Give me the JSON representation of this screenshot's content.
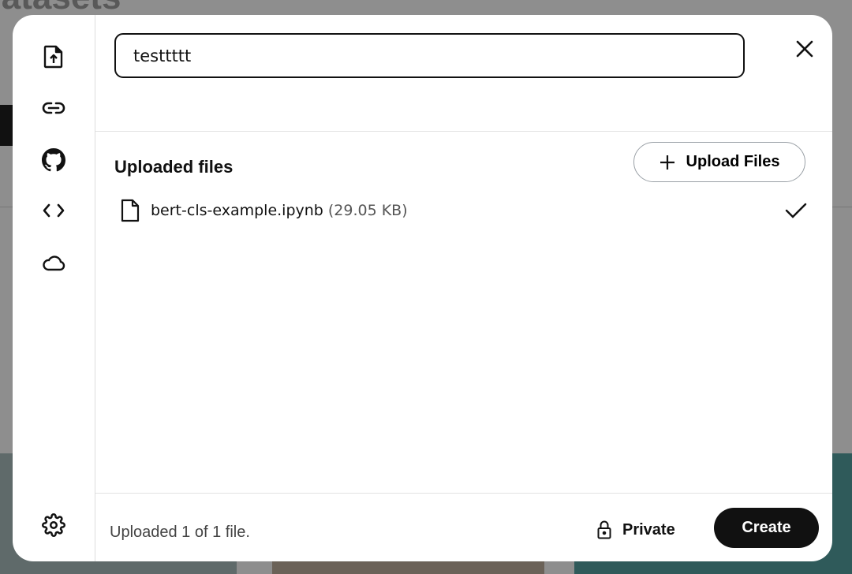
{
  "background": {
    "page_title": "Datasets"
  },
  "sidebar": {
    "items": [
      {
        "icon": "file-upload-icon"
      },
      {
        "icon": "link-icon"
      },
      {
        "icon": "github-icon"
      },
      {
        "icon": "code-icon"
      },
      {
        "icon": "cloud-icon"
      }
    ],
    "settings_icon": "gear-icon"
  },
  "header": {
    "title_input_value": "testtttt",
    "close_icon": "close-icon"
  },
  "files": {
    "heading": "Uploaded files",
    "upload_button": "Upload Files",
    "items": [
      {
        "name": "bert-cls-example.ipynb",
        "size": "(29.05 KB)",
        "status": "complete"
      }
    ]
  },
  "footer": {
    "status": "Uploaded 1 of 1 file.",
    "visibility": "Private",
    "create_button": "Create"
  }
}
